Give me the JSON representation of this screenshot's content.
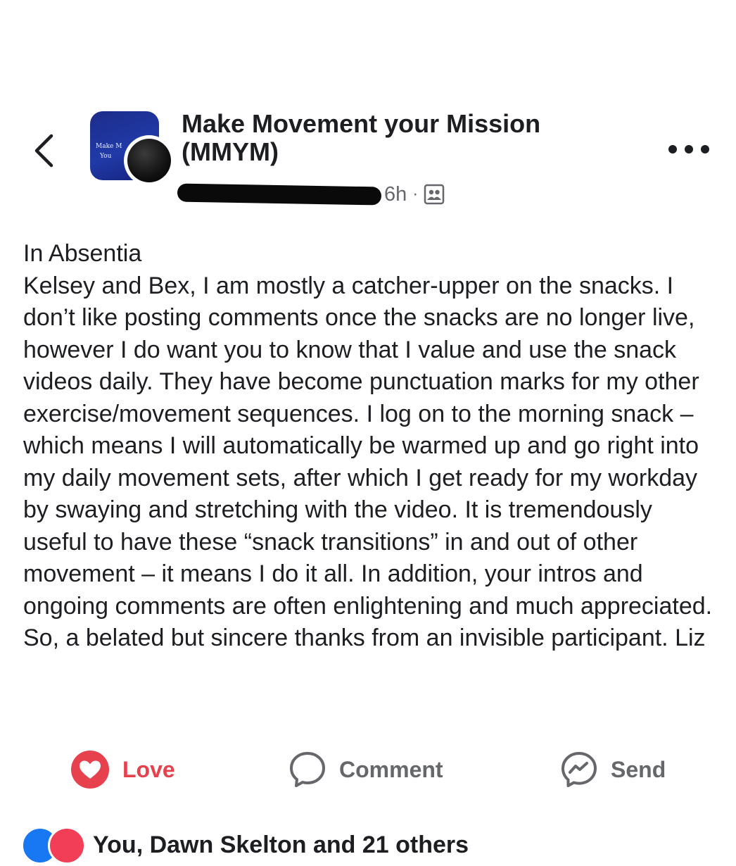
{
  "post": {
    "group_name": "Make Movement your Mission (MMYM)",
    "group_avatar_text": [
      "Make M",
      "You"
    ],
    "time": "6h",
    "separator": "·",
    "audience_icon": "group-audience-icon",
    "title_line": "In Absentia",
    "body": "Kelsey and Bex, I am mostly a catcher-upper on the snacks. I don’t like posting comments once the snacks are no longer live, however I do want you to know that I value and use the snack videos daily. They have become punctuation marks for my other exercise/movement sequences. I log on to the morning snack – which means I will automatically be warmed up and go right into my daily movement sets, after which I get ready for my workday by swaying and stretching with the video. It is tremendously useful to have these “snack transitions” in and out of other movement – it means I do it all. In addition, your intros and ongoing comments are often enlightening and much appreciated. So, a belated but sincere thanks from an invisible participant. Liz"
  },
  "actions": {
    "love": "Love",
    "comment": "Comment",
    "send": "Send"
  },
  "reactions": {
    "summary": "You, Dawn Skelton and 21 others"
  },
  "colors": {
    "love_accent": "#e8414e",
    "secondary_text": "#65676b",
    "primary_text": "#1c1e21",
    "like_blue": "#1877f2"
  },
  "icons": {
    "back": "chevron-left-icon",
    "more": "more-horizontal-icon",
    "love": "heart-icon",
    "comment": "comment-bubble-icon",
    "send": "messenger-icon"
  }
}
